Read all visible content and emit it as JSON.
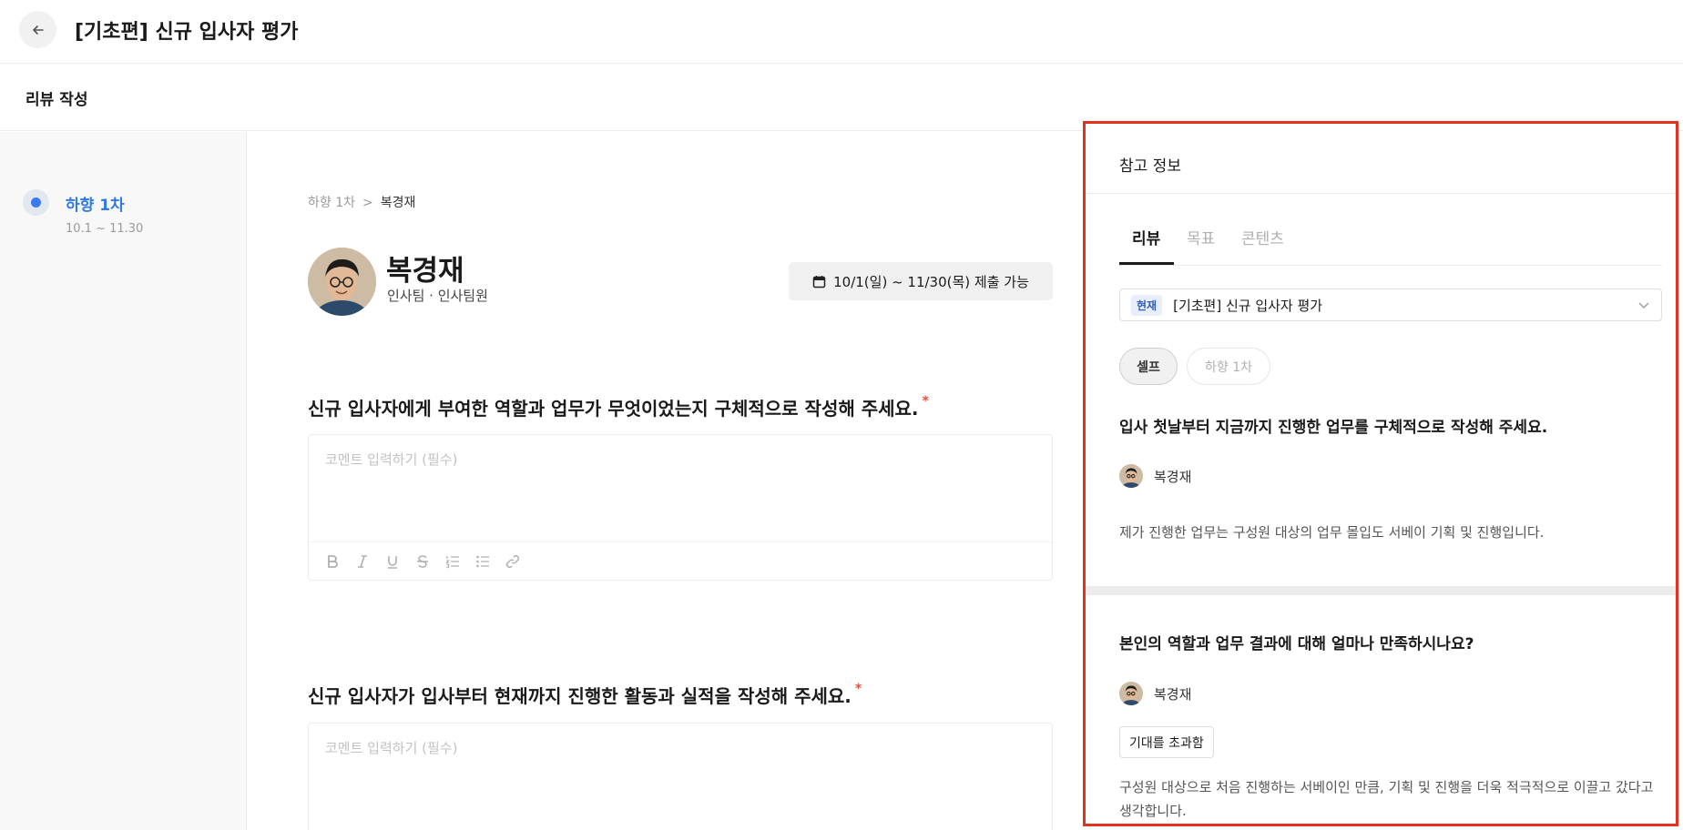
{
  "header": {
    "title": "[기초편] 신규 입사자 평가"
  },
  "subheader": {
    "label": "리뷰 작성"
  },
  "steps": [
    {
      "name": "하향 1차",
      "range": "10.1 ~ 11.30"
    }
  ],
  "breadcrumb": {
    "parent": "하향 1차",
    "separator": ">",
    "current": "복경재"
  },
  "person": {
    "name": "복경재",
    "team": "인사팀 · 인사팀원"
  },
  "period": {
    "text": "10/1(일) ~ 11/30(목) 제출 가능"
  },
  "questions": [
    {
      "text": "신규 입사자에게 부여한 역할과 업무가 무엇이었는지 구체적으로 작성해 주세요.",
      "required_mark": "*",
      "placeholder": "코멘트 입력하기 (필수)"
    },
    {
      "text": "신규 입사자가 입사부터 현재까지 진행한 활동과 실적을 작성해 주세요.",
      "required_mark": "*",
      "placeholder": "코멘트 입력하기 (필수)"
    }
  ],
  "reference": {
    "title": "참고 정보",
    "tabs": [
      "리뷰",
      "목표",
      "콘텐츠"
    ],
    "select": {
      "badge": "현재",
      "value": "[기초편] 신규 입사자 평가"
    },
    "chips": [
      "셀프",
      "하향 1차"
    ],
    "items": [
      {
        "question": "입사 첫날부터 지금까지 진행한 업무를 구체적으로 작성해 주세요.",
        "reviewer": "복경재",
        "answer": "제가 진행한 업무는 구성원 대상의 업무 몰입도 서베이 기획 및 진행입니다."
      },
      {
        "question": "본인의 역할과 업무 결과에 대해 얼마나 만족하시나요?",
        "reviewer": "복경재",
        "rating": "기대를 초과함",
        "answer": "구성원 대상으로 처음 진행하는 서베이인 만큼, 기획 및 진행을 더욱 적극적으로 이끌고 갔다고 생각합니다."
      }
    ]
  },
  "colors": {
    "accent": "#2f7ae5",
    "highlight_border": "#e3331e",
    "required": "#e0533d"
  }
}
